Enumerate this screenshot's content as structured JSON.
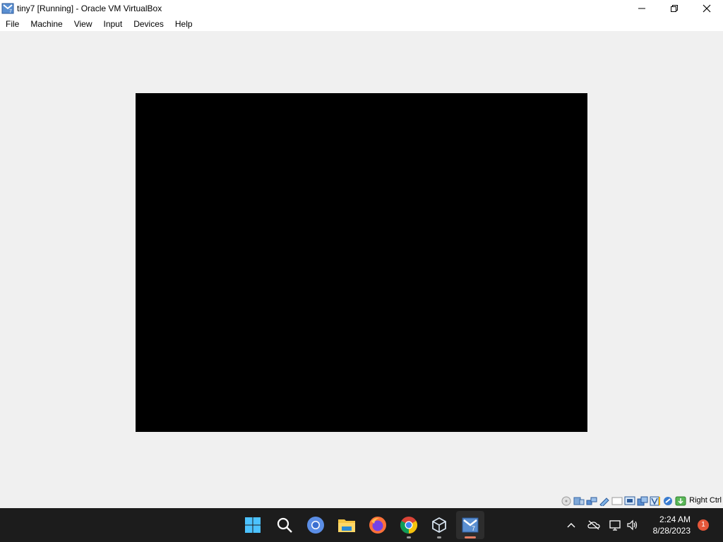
{
  "window": {
    "title": "tiny7 [Running] - Oracle VM VirtualBox",
    "app_icon": "virtualbox-icon",
    "controls": [
      "minimize-icon",
      "restore-icon",
      "close-icon"
    ]
  },
  "menubar": {
    "items": [
      {
        "label": "File"
      },
      {
        "label": "Machine"
      },
      {
        "label": "View"
      },
      {
        "label": "Input"
      },
      {
        "label": "Devices"
      },
      {
        "label": "Help"
      }
    ]
  },
  "vm_display": {
    "screen_color": "#000000"
  },
  "statusbar": {
    "icons": [
      "hard-disk-icon",
      "optical-drive-icon",
      "audio-icon",
      "network-icon",
      "usb-icon",
      "shared-folders-icon",
      "display-icon",
      "video-capture-icon",
      "virtualization-icon",
      "mouse-integration-icon",
      "keyboard-capture-icon"
    ],
    "host_key": "Right Ctrl"
  },
  "taskbar": {
    "apps": [
      "windows-start-icon",
      "search-icon",
      "chromium-icon",
      "file-explorer-icon",
      "firefox-icon",
      "chrome-icon",
      "virtualbox-manager-icon",
      "virtualbox-vm-icon"
    ],
    "tray_icons": [
      "chevron-up-icon",
      "onedrive-icon",
      "network-icon",
      "volume-icon"
    ],
    "time": "2:24 AM",
    "date": "8/28/2023",
    "notification_count": "1",
    "accent": "#e57d62"
  }
}
